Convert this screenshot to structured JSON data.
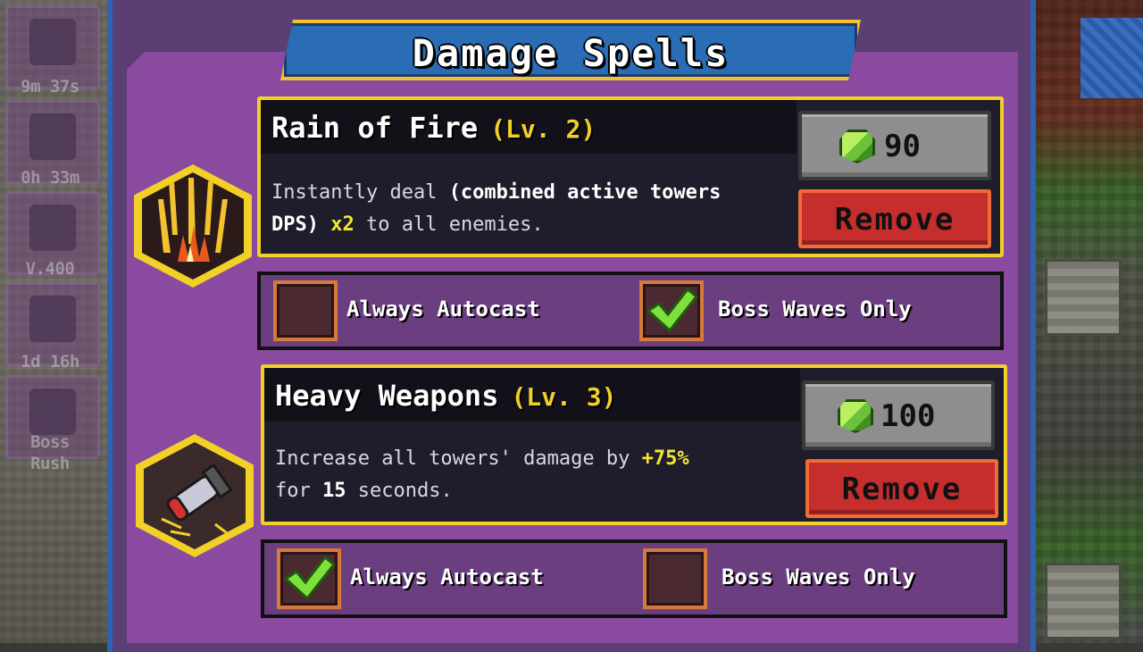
{
  "side_menu": {
    "items": [
      {
        "label": "9m 37s"
      },
      {
        "label": "0h 33m"
      },
      {
        "label": "V.400"
      },
      {
        "label": "1d 16h"
      },
      {
        "label": "Boss"
      },
      {
        "label": "Rush"
      }
    ]
  },
  "title": "Damage Spells",
  "spells": [
    {
      "name": "Rain of Fire",
      "level": "(Lv. 2)",
      "desc_1": "Instantly deal ",
      "desc_bold": "(combined active towers DPS)",
      "desc_hl": " x2",
      "desc_2": " to all enemies.",
      "cost": "90",
      "remove_label": "Remove",
      "icon": "fire-rain-icon",
      "opt_autocast": "Always Autocast",
      "opt_boss": "Boss Waves Only",
      "autocast_checked": false,
      "boss_checked": true
    },
    {
      "name": "Heavy Weapons",
      "level": "(Lv. 3)",
      "desc_1": "Increase all towers' damage by ",
      "desc_hl": "+75%",
      "desc_2": " for ",
      "desc_bold": "15",
      "desc_3": " seconds.",
      "cost": "100",
      "remove_label": "Remove",
      "icon": "missile-icon",
      "opt_autocast": "Always Autocast",
      "opt_boss": "Boss Waves Only",
      "autocast_checked": true,
      "boss_checked": false
    }
  ],
  "colors": {
    "accent": "#f2d028",
    "panel": "#8a4aa0",
    "remove": "#c62e2e",
    "gem": "#6cc23a"
  }
}
